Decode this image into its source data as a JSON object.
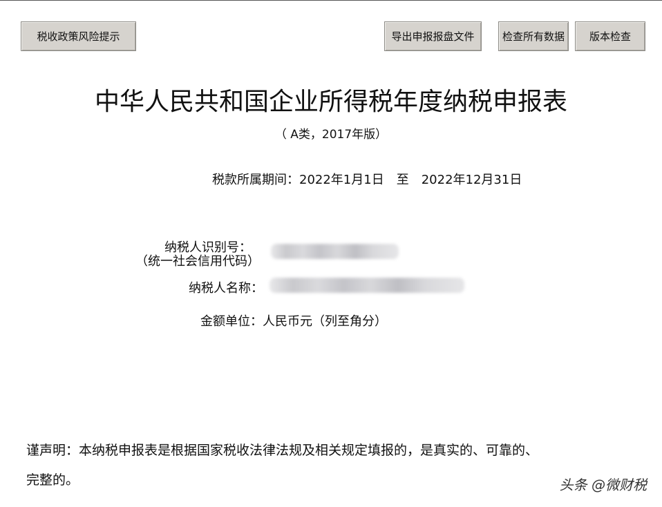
{
  "toolbar": {
    "risk_tips": "税收政策风险提示",
    "export_file": "导出申报报盘文件",
    "check_all": "检查所有数据",
    "version_check": "版本检查"
  },
  "form": {
    "title": "中华人民共和国企业所得税年度纳税申报表",
    "subtitle": "（ A类，2017年版）",
    "period_label": "税款所属期间：",
    "period_start": "2022年1月1日",
    "period_to": "至",
    "period_end": "2022年12月31日",
    "taxpayer_id_label": "纳税人识别号：",
    "taxpayer_id_sub": "（统一社会信用代码）",
    "taxpayer_name_label": "纳税人名称：",
    "currency_label": "金额单位：",
    "currency_value": "人民币元（列至角分）",
    "declaration_line1": "谨声明：本纳税申报表是根据国家税收法律法规及相关规定填报的，是真实的、可靠的、",
    "declaration_line2": "完整的。"
  },
  "watermark": "头条 @微财税"
}
